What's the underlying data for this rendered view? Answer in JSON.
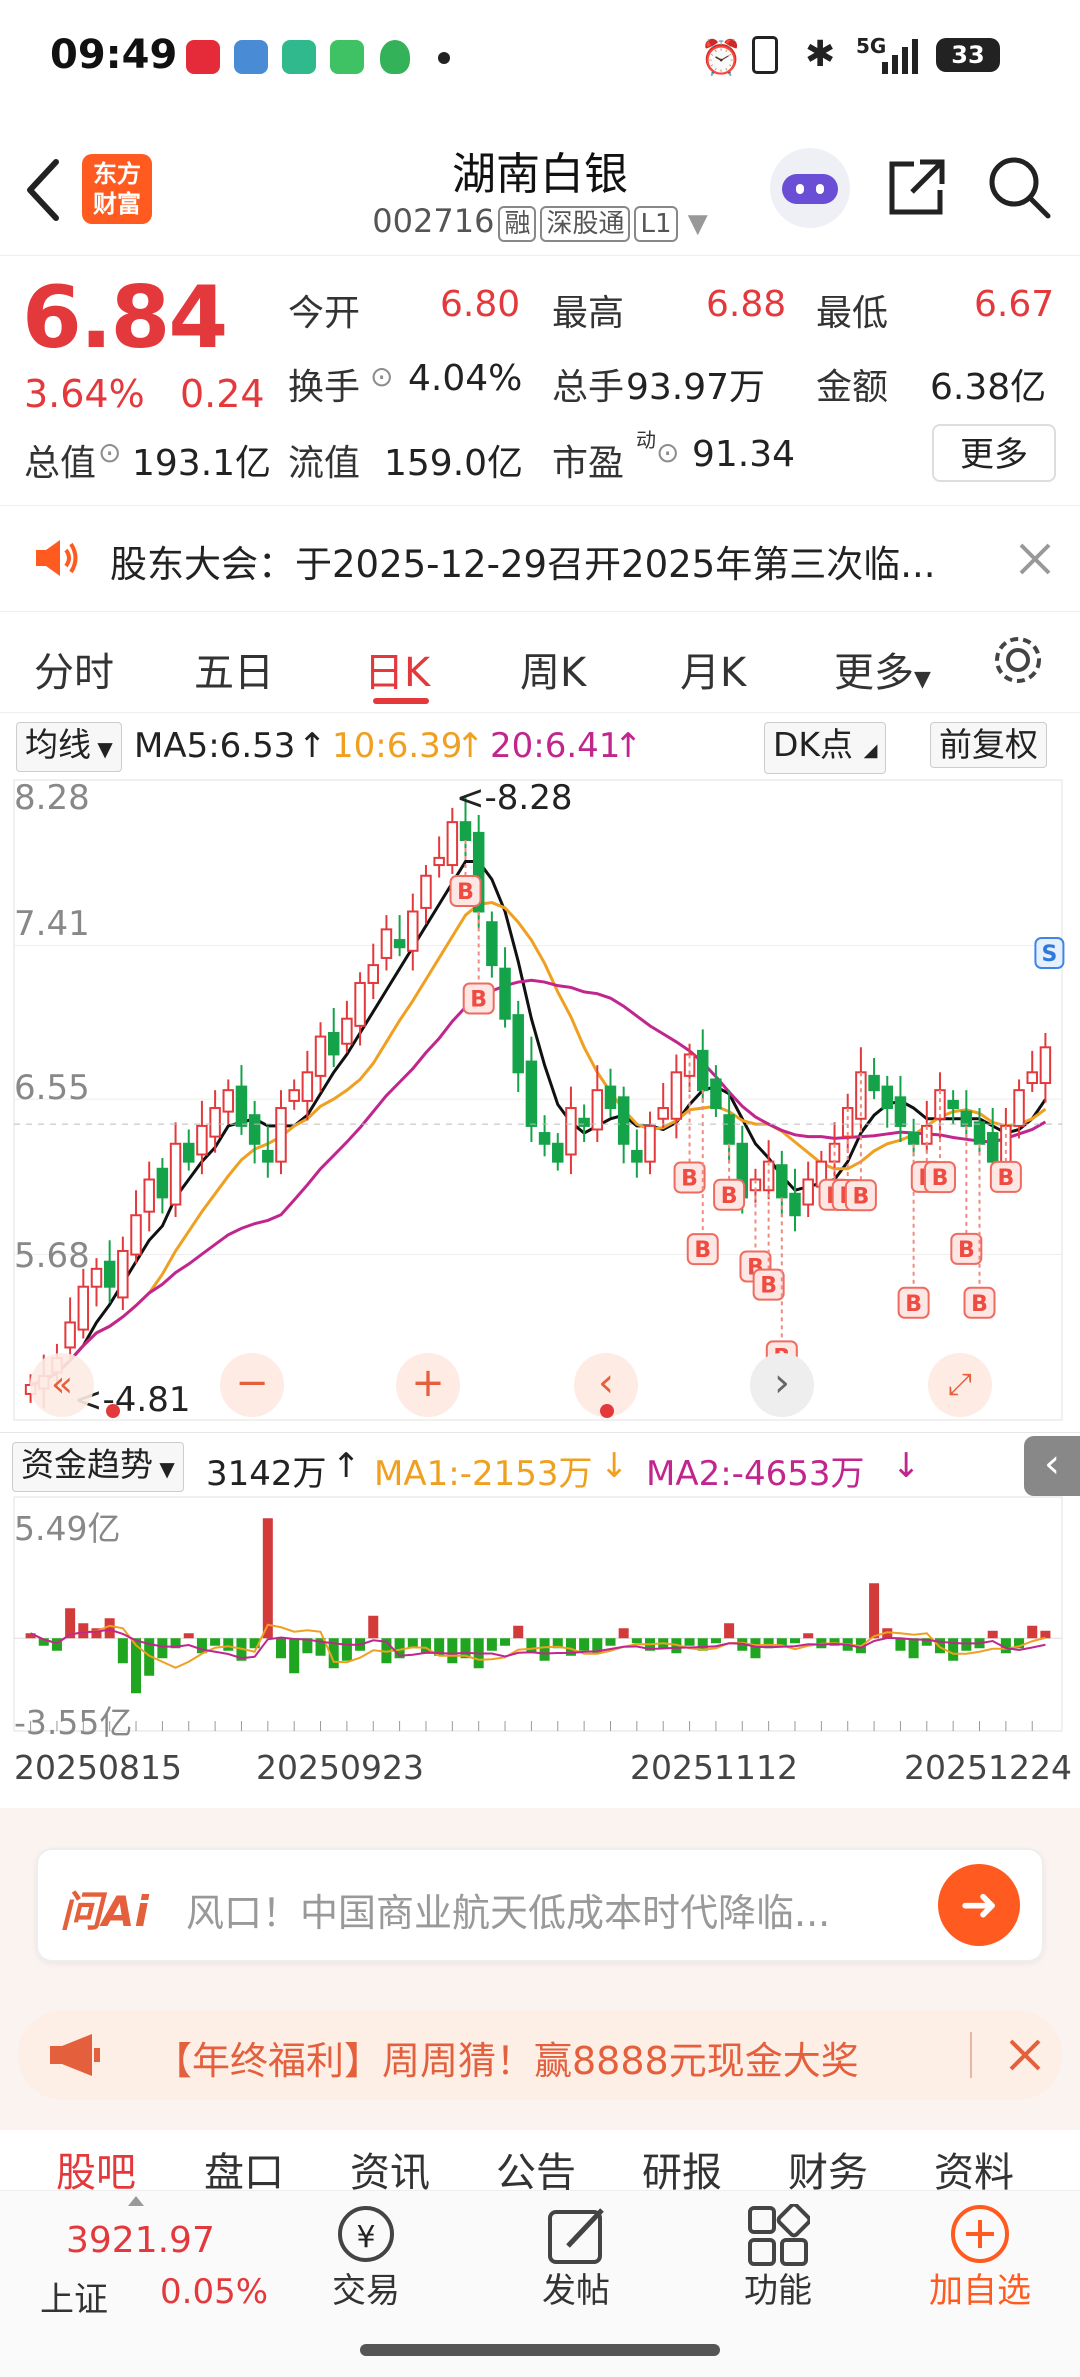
{
  "status_bar": {
    "time": "09:49",
    "battery": "33",
    "network": "5G"
  },
  "header": {
    "logo_text_top": "东方",
    "logo_text_bottom": "财富",
    "name": "湖南白银",
    "code": "002716",
    "tags": [
      "融",
      "深股通",
      "L1"
    ]
  },
  "quote": {
    "price": "6.84",
    "change_pct": "3.64%",
    "change": "0.24",
    "open_label": "今开",
    "open": "6.80",
    "high_label": "最高",
    "high": "6.88",
    "low_label": "最低",
    "low": "6.67",
    "turnover_label": "换手",
    "turnover": "4.04%",
    "volume_label": "总手",
    "volume": "93.97万",
    "amount_label": "金额",
    "amount": "6.38亿",
    "mktcap_label": "总值",
    "mktcap": "193.1亿",
    "float_label": "流值",
    "float": "159.0亿",
    "pe_label": "市盈",
    "pe_sup": "动",
    "pe": "91.34",
    "more_label": "更多"
  },
  "notice": {
    "text": "股东大会：于2025-12-29召开2025年第三次临..."
  },
  "kline_tabs": [
    "分时",
    "五日",
    "日K",
    "周K",
    "月K",
    "更多"
  ],
  "kline_active": "日K",
  "main_chart_legend": {
    "selector": "均线",
    "ma5": "MA5:6.53",
    "ma10": "10:6.39",
    "ma20": "20:6.41",
    "dk_label": "DK点",
    "adjust_label": "前复权"
  },
  "colors": {
    "up": "#e4393c",
    "down": "#15a34a",
    "ma5": "#111111",
    "ma10": "#f0a020",
    "ma20": "#c0268e",
    "accent": "#ff5a1f"
  },
  "chart_data": [
    {
      "type": "candlestick",
      "ylim": [
        4.81,
        8.28
      ],
      "y_tick_labels": [
        "8.28",
        "7.41",
        "6.55",
        "5.68"
      ],
      "max_label": "8.28",
      "min_label": "4.81",
      "series": [
        {
          "name": "MA5",
          "last": 6.53
        },
        {
          "name": "MA10",
          "last": 6.39
        },
        {
          "name": "MA20",
          "last": 6.41
        }
      ],
      "closes": [
        4.95,
        5.0,
        5.1,
        5.3,
        5.5,
        5.6,
        5.5,
        5.7,
        5.9,
        6.1,
        6.0,
        6.3,
        6.2,
        6.4,
        6.5,
        6.6,
        6.4,
        6.3,
        6.2,
        6.5,
        6.6,
        6.7,
        6.9,
        6.8,
        7.0,
        7.2,
        7.3,
        7.5,
        7.4,
        7.6,
        7.8,
        7.9,
        8.1,
        8.0,
        7.6,
        7.3,
        7.0,
        6.7,
        6.4,
        6.3,
        6.2,
        6.5,
        6.4,
        6.6,
        6.5,
        6.3,
        6.2,
        6.4,
        6.5,
        6.7,
        6.8,
        6.6,
        6.5,
        6.3,
        6.0,
        6.1,
        6.2,
        6.0,
        5.9,
        6.1,
        6.2,
        6.3,
        6.5,
        6.7,
        6.6,
        6.5,
        6.4,
        6.3,
        6.4,
        6.6,
        6.5,
        6.4,
        6.3,
        6.2,
        6.4,
        6.6,
        6.7,
        6.84
      ],
      "signals": [
        {
          "label": "B",
          "count": 3
        },
        {
          "label": "B",
          "count": 12
        },
        {
          "label": "S",
          "count": 1
        }
      ]
    },
    {
      "type": "bar",
      "name": "资金趋势",
      "ylim": [
        -3.55,
        5.49
      ],
      "y_tick_labels": [
        "5.49亿",
        "-3.55亿"
      ],
      "x_tick_labels": [
        "20250815",
        "20250923",
        "20251112",
        "20251224"
      ],
      "values": [
        0.2,
        -0.3,
        -0.5,
        1.2,
        0.6,
        0.4,
        0.8,
        -1.0,
        -2.2,
        -1.5,
        -0.8,
        -0.4,
        0.2,
        -0.6,
        -0.3,
        -0.5,
        -0.9,
        -0.4,
        4.8,
        -0.8,
        -1.4,
        -0.6,
        -0.7,
        -1.2,
        -0.9,
        -0.5,
        0.9,
        -1.0,
        -0.8,
        -0.4,
        -0.6,
        -0.7,
        -1.0,
        -0.8,
        -1.2,
        -0.5,
        -0.3,
        0.5,
        -0.6,
        -0.9,
        -0.4,
        -0.7,
        -0.5,
        -0.6,
        -0.3,
        0.4,
        -0.2,
        -0.5,
        -0.4,
        -0.6,
        -0.3,
        -0.5,
        -0.2,
        0.6,
        -0.5,
        -0.8,
        -0.4,
        -0.3,
        -0.2,
        0.2,
        -0.4,
        -0.3,
        -0.5,
        -0.6,
        2.2,
        0.4,
        -0.5,
        -0.8,
        -0.3,
        -0.6,
        -0.9,
        -0.5,
        -0.4,
        0.3,
        -0.6,
        -0.4,
        0.5,
        0.3
      ],
      "legend": {
        "selector": "资金趋势",
        "value": "3142万",
        "ma1": "MA1:-2153万",
        "ma2": "MA2:-4653万"
      }
    }
  ],
  "ask": {
    "brand": "问Ai",
    "placeholder": "风口！中国商业航天低成本时代降临..."
  },
  "promo": {
    "text": "【年终福利】周周猜！赢8888元现金大奖"
  },
  "bottom_tabs": [
    "股吧",
    "盘口",
    "资讯",
    "公告",
    "研报",
    "财务",
    "资料"
  ],
  "bottom_tab_active": "股吧",
  "index": {
    "value": "3921.97",
    "name": "上证",
    "change": "0.05%"
  },
  "nav": {
    "trade": "交易",
    "post": "发帖",
    "func": "功能",
    "add": "加自选"
  }
}
